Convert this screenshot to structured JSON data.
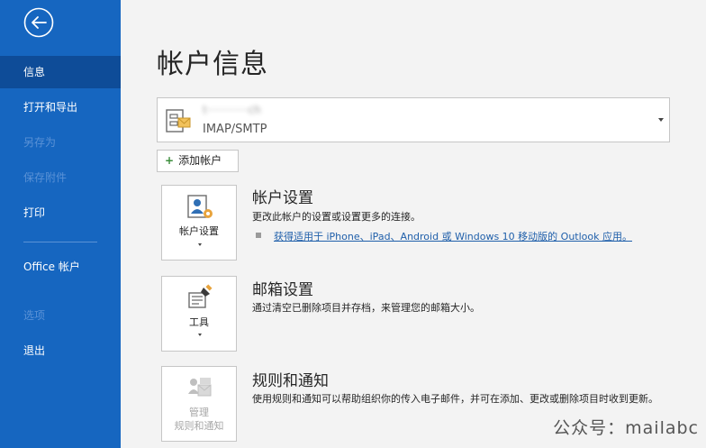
{
  "sidebar": {
    "back_icon": "back-arrow-icon",
    "items": [
      {
        "label": "信息",
        "state": "active"
      },
      {
        "label": "打开和导出",
        "state": "normal"
      },
      {
        "label": "另存为",
        "state": "disabled"
      },
      {
        "label": "保存附件",
        "state": "disabled"
      },
      {
        "label": "打印",
        "state": "normal"
      },
      {
        "label": "Office 帐户",
        "state": "normal"
      },
      {
        "label": "选项",
        "state": "disabled"
      },
      {
        "label": "退出",
        "state": "normal"
      }
    ],
    "colors": {
      "background": "#1666c0",
      "active": "#0e4c98",
      "disabled_text": "#5a92d6"
    }
  },
  "main": {
    "title": "帐户信息",
    "account": {
      "name": "t············ch",
      "type": "IMAP/SMTP"
    },
    "add_account_label": "添加帐户",
    "sections": [
      {
        "tile_label": "帐户设置",
        "title": "帐户设置",
        "description": "更改此帐户的设置或设置更多的连接。",
        "link": "获得适用于 iPhone、iPad、Android 或 Windows 10 移动版的 Outlook 应用。"
      },
      {
        "tile_label": "工具",
        "title": "邮箱设置",
        "description": "通过清空已删除项目并存档，来管理您的邮箱大小。"
      },
      {
        "tile_label_line1": "管理",
        "tile_label_line2": "规则和通知",
        "title": "规则和通知",
        "description": "使用规则和通知可以帮助组织你的传入电子邮件，并可在添加、更改或删除项目时收到更新。"
      }
    ]
  },
  "watermark": "公众号：mailabc"
}
